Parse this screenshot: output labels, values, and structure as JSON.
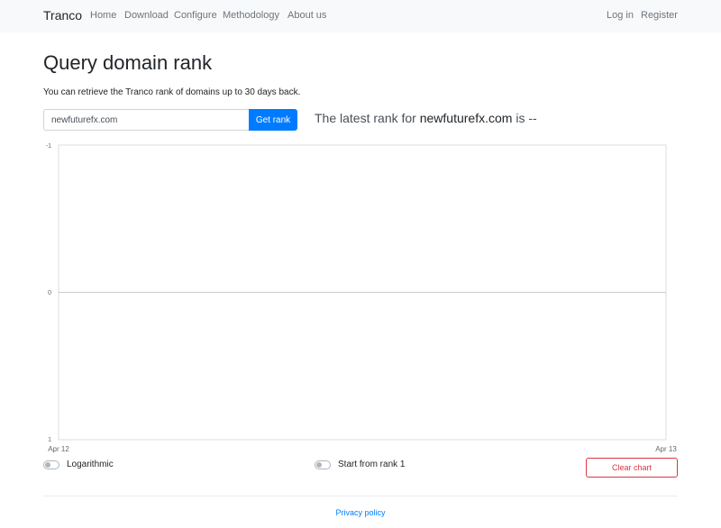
{
  "navbar": {
    "brand": "Tranco",
    "links": [
      "Home",
      "Download",
      "Configure",
      "Methodology",
      "About us"
    ],
    "auth": {
      "login": "Log in",
      "register": "Register"
    }
  },
  "main": {
    "title": "Query domain rank",
    "lead": "You can retrieve the Tranco rank of domains up to 30 days back.",
    "search": {
      "value": "newfuturefx.com",
      "button": "Get rank"
    },
    "result": {
      "prefix": "The latest rank for ",
      "domain": "newfuturefx.com",
      "suffix": " is --"
    }
  },
  "chart_data": {
    "type": "line",
    "x_ticks": [
      "Apr 12",
      "Apr 13"
    ],
    "y_ticks": [
      "-1",
      "0",
      "1"
    ],
    "ylim": [
      -1,
      1
    ],
    "series": [],
    "grid": true
  },
  "controls": {
    "logarithmic": "Logarithmic",
    "start_from_rank": "Start from rank 1",
    "clear_chart": "Clear chart"
  },
  "footer": {
    "privacy": "Privacy policy"
  },
  "colors": {
    "primary": "#007bff",
    "danger": "#dc3545",
    "navbar_bg": "#f8f9fa"
  }
}
